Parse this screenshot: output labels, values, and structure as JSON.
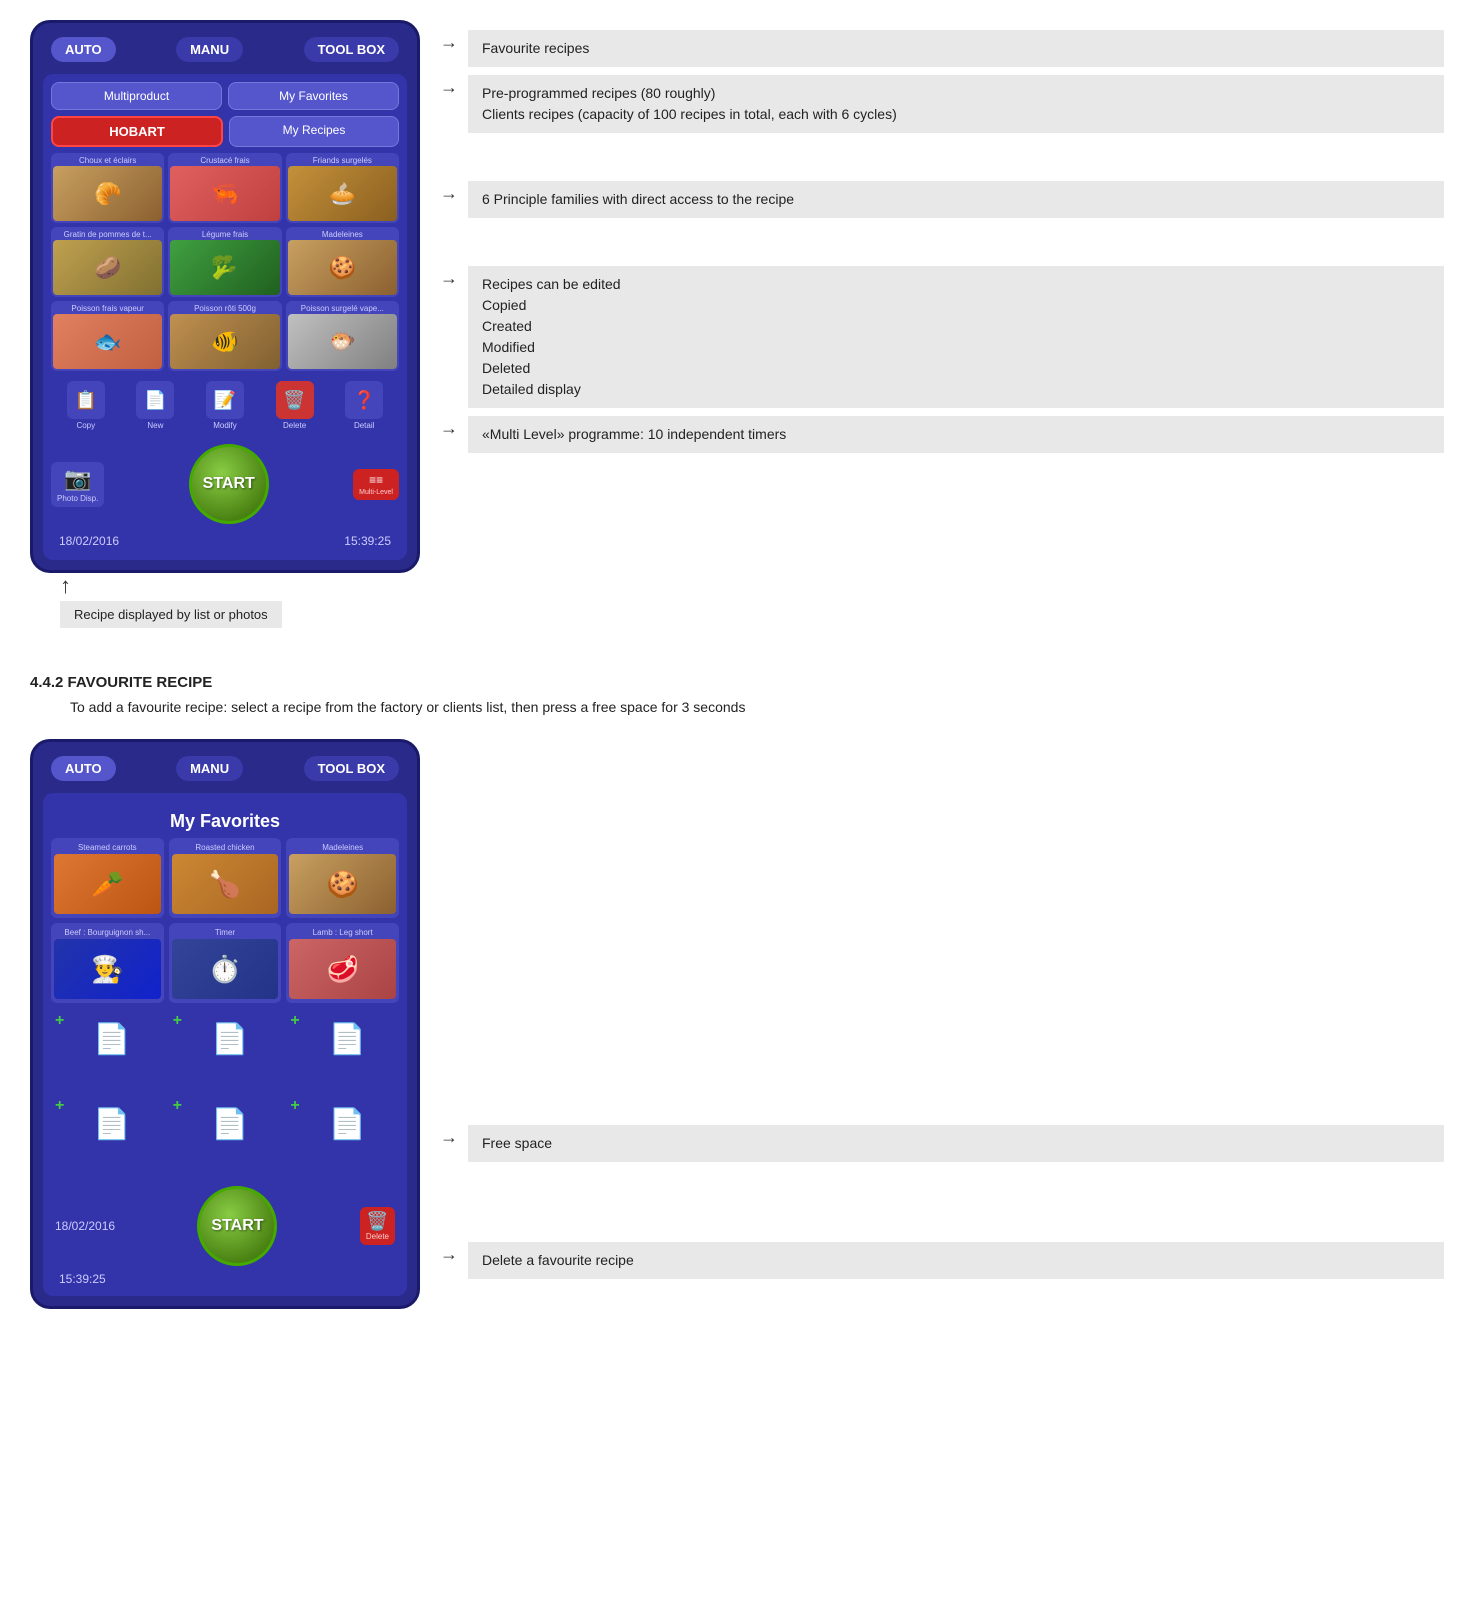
{
  "top_device": {
    "header": {
      "auto": "AUTO",
      "manu": "MANU",
      "toolbox": "TOOL BOX"
    },
    "buttons": {
      "multiproduct": "Multiproduct",
      "my_favorites": "My Favorites",
      "hobart": "HOBART",
      "my_recipes": "My Recipes"
    },
    "recipe_items": [
      {
        "label": "Choux et éclairs",
        "emoji": "🥐",
        "bg": "img-pastry"
      },
      {
        "label": "Crustacé frais",
        "emoji": "🦐",
        "bg": "img-seafood"
      },
      {
        "label": "Friands surgelés",
        "emoji": "🥧",
        "bg": "img-pastry2"
      },
      {
        "label": "Gratin de pommes de t...",
        "emoji": "🥔",
        "bg": "img-potato"
      },
      {
        "label": "Légume frais",
        "emoji": "🥦",
        "bg": "img-veggie"
      },
      {
        "label": "Madeleines",
        "emoji": "🍪",
        "bg": "img-madeleine"
      },
      {
        "label": "Poisson frais vapeur",
        "emoji": "🐟",
        "bg": "img-fish1"
      },
      {
        "label": "Poisson rôti 500g",
        "emoji": "🐠",
        "bg": "img-fish2"
      },
      {
        "label": "Poisson surgelé vape...",
        "emoji": "🐡",
        "bg": "img-fish3"
      }
    ],
    "actions": [
      {
        "label": "Copy",
        "emoji": "📋",
        "type": "normal"
      },
      {
        "label": "New",
        "emoji": "📄",
        "type": "normal"
      },
      {
        "label": "Modify",
        "emoji": "📝",
        "type": "normal"
      },
      {
        "label": "Delete",
        "emoji": "🗑️",
        "type": "delete"
      },
      {
        "label": "Detail",
        "emoji": "❓",
        "type": "normal"
      }
    ],
    "bottom": {
      "date": "18/02/2016",
      "start": "START",
      "time": "15:39:25",
      "photo_disp": "Photo Disp.",
      "multi_level": "Multi-Level"
    }
  },
  "annotations": [
    {
      "text": "Favourite recipes"
    },
    {
      "text": "Pre-programmed recipes (80 roughly)\nClients recipes (capacity of 100 recipes in total, each with 6 cycles)"
    },
    {
      "text": "6 Principle families with direct access to the recipe"
    },
    {
      "text": "Recipes can be edited\n        Copied\n        Created\n        Modified\n        Deleted\nDetailed display"
    },
    {
      "text": "«Multi Level» programme: 10 independent timers"
    }
  ],
  "device_bottom_label": "Recipe displayed by list or photos",
  "section": {
    "heading": "4.4.2 FAVOURITE RECIPE",
    "description": "To add a favourite recipe: select a recipe from the factory or clients list, then press a free space for 3 seconds"
  },
  "favorites_device": {
    "header": {
      "auto": "AUTO",
      "manu": "MANU",
      "toolbox": "TOOL BOX"
    },
    "title": "My Favorites",
    "recipes": [
      {
        "label": "Steamed carrots",
        "emoji": "🥕",
        "bg": "carrot-bg"
      },
      {
        "label": "Roasted chicken",
        "emoji": "🍗",
        "bg": "chicken-bg"
      },
      {
        "label": "Madeleines",
        "emoji": "🍪",
        "bg": "madeleine-bg"
      },
      {
        "label": "Beef : Bourguignon sh...",
        "emoji": "👨‍🍳",
        "bg": "chef-hat-bg",
        "is_chef": true
      },
      {
        "label": "Timer",
        "emoji": "⏱️",
        "bg": "timer-bg",
        "is_timer": true
      },
      {
        "label": "Lamb : Leg short",
        "emoji": "🥩",
        "bg": "lamb-bg"
      }
    ],
    "empty_slots": 6,
    "bottom": {
      "date": "18/02/2016",
      "start": "START",
      "time": "15:39:25",
      "delete": "Delete"
    }
  },
  "bottom_annotations": [
    {
      "text": "Free space"
    },
    {
      "text": "Delete a favourite recipe"
    }
  ]
}
